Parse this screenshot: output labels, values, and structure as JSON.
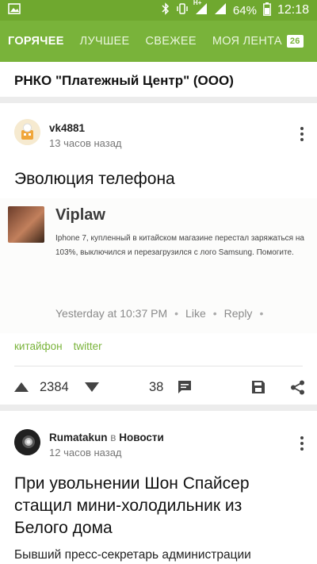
{
  "status_bar": {
    "battery_percent": "64%",
    "time": "12:18",
    "network": "H+"
  },
  "tabs": [
    {
      "label": "ГОРЯЧЕЕ",
      "active": true
    },
    {
      "label": "ЛУЧШЕЕ",
      "active": false
    },
    {
      "label": "СВЕЖЕЕ",
      "active": false
    },
    {
      "label": "МОЯ ЛЕНТА",
      "active": false,
      "badge": "26"
    }
  ],
  "previous_post": {
    "title": "РНКО \"Платежный Центр\" (ООО)"
  },
  "post1": {
    "author": "vk4881",
    "time": "13 часов назад",
    "title": "Эволюция телефона",
    "embed": {
      "name": "Viplaw",
      "text": "Iphone 7, купленный в китайском магазине перестал заряжаться на 103%, выключился и перезагрузился с лого Samsung. Помогите.",
      "timestamp": "Yesterday at 10:37 PM",
      "like": "Like",
      "reply": "Reply"
    },
    "tags": [
      "китайфон",
      "twitter"
    ],
    "rating": "2384",
    "comments": "38"
  },
  "post2": {
    "author": "Rumatakun",
    "community_prefix": "в",
    "community": "Новости",
    "time": "12 часов назад",
    "title": "При увольнении Шон Спайсер стащил мини-холодильник из Белого дома",
    "excerpt": "Бывший пресс-секретарь администрации"
  },
  "colors": {
    "brand_green": "#79b33a",
    "status_green": "#6fa82f"
  }
}
